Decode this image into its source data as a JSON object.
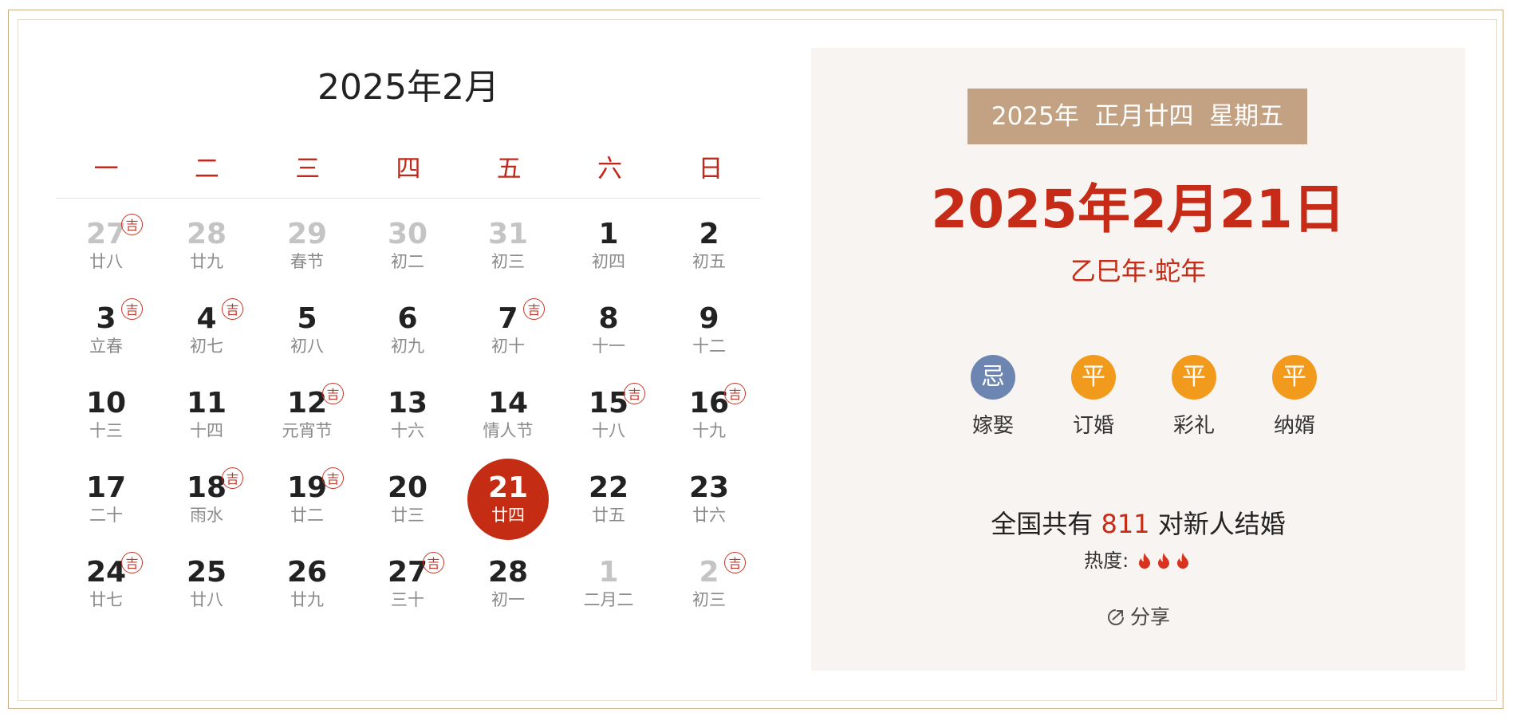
{
  "calendar": {
    "title": "2025年2月",
    "weekdays": [
      "一",
      "二",
      "三",
      "四",
      "五",
      "六",
      "日"
    ],
    "ji_label": "吉",
    "days": [
      {
        "n": "27",
        "l": "廿八",
        "other": true,
        "ji": true
      },
      {
        "n": "28",
        "l": "廿九",
        "other": true,
        "ji": false
      },
      {
        "n": "29",
        "l": "春节",
        "other": true,
        "ji": false
      },
      {
        "n": "30",
        "l": "初二",
        "other": true,
        "ji": false
      },
      {
        "n": "31",
        "l": "初三",
        "other": true,
        "ji": false
      },
      {
        "n": "1",
        "l": "初四",
        "other": false,
        "ji": false
      },
      {
        "n": "2",
        "l": "初五",
        "other": false,
        "ji": false
      },
      {
        "n": "3",
        "l": "立春",
        "other": false,
        "ji": true
      },
      {
        "n": "4",
        "l": "初七",
        "other": false,
        "ji": true
      },
      {
        "n": "5",
        "l": "初八",
        "other": false,
        "ji": false
      },
      {
        "n": "6",
        "l": "初九",
        "other": false,
        "ji": false
      },
      {
        "n": "7",
        "l": "初十",
        "other": false,
        "ji": true
      },
      {
        "n": "8",
        "l": "十一",
        "other": false,
        "ji": false
      },
      {
        "n": "9",
        "l": "十二",
        "other": false,
        "ji": false
      },
      {
        "n": "10",
        "l": "十三",
        "other": false,
        "ji": false
      },
      {
        "n": "11",
        "l": "十四",
        "other": false,
        "ji": false
      },
      {
        "n": "12",
        "l": "元宵节",
        "other": false,
        "ji": true
      },
      {
        "n": "13",
        "l": "十六",
        "other": false,
        "ji": false
      },
      {
        "n": "14",
        "l": "情人节",
        "other": false,
        "ji": false
      },
      {
        "n": "15",
        "l": "十八",
        "other": false,
        "ji": true
      },
      {
        "n": "16",
        "l": "十九",
        "other": false,
        "ji": true
      },
      {
        "n": "17",
        "l": "二十",
        "other": false,
        "ji": false
      },
      {
        "n": "18",
        "l": "雨水",
        "other": false,
        "ji": true
      },
      {
        "n": "19",
        "l": "廿二",
        "other": false,
        "ji": true
      },
      {
        "n": "20",
        "l": "廿三",
        "other": false,
        "ji": false
      },
      {
        "n": "21",
        "l": "廿四",
        "other": false,
        "ji": false,
        "selected": true
      },
      {
        "n": "22",
        "l": "廿五",
        "other": false,
        "ji": false
      },
      {
        "n": "23",
        "l": "廿六",
        "other": false,
        "ji": false
      },
      {
        "n": "24",
        "l": "廿七",
        "other": false,
        "ji": true
      },
      {
        "n": "25",
        "l": "廿八",
        "other": false,
        "ji": false
      },
      {
        "n": "26",
        "l": "廿九",
        "other": false,
        "ji": false
      },
      {
        "n": "27",
        "l": "三十",
        "other": false,
        "ji": true
      },
      {
        "n": "28",
        "l": "初一",
        "other": false,
        "ji": false
      },
      {
        "n": "1",
        "l": "二月二",
        "other": true,
        "ji": false
      },
      {
        "n": "2",
        "l": "初三",
        "other": true,
        "ji": true
      }
    ]
  },
  "panel": {
    "badge": "2025年  正月廿四  星期五",
    "date": "2025年2月21日",
    "ganzhi": "乙巳年·蛇年",
    "activities": [
      {
        "mark": "忌",
        "label": "嫁娶",
        "color": "#6d86b1"
      },
      {
        "mark": "平",
        "label": "订婚",
        "color": "#f19a1c"
      },
      {
        "mark": "平",
        "label": "彩礼",
        "color": "#f19a1c"
      },
      {
        "mark": "平",
        "label": "纳婿",
        "color": "#f19a1c"
      }
    ],
    "stat_prefix": "全国共有 ",
    "stat_count": "811",
    "stat_suffix": " 对新人结婚",
    "heat_label": "热度:",
    "heat_level": 3,
    "flame_color": "#d9321e",
    "share_label": "分享"
  }
}
